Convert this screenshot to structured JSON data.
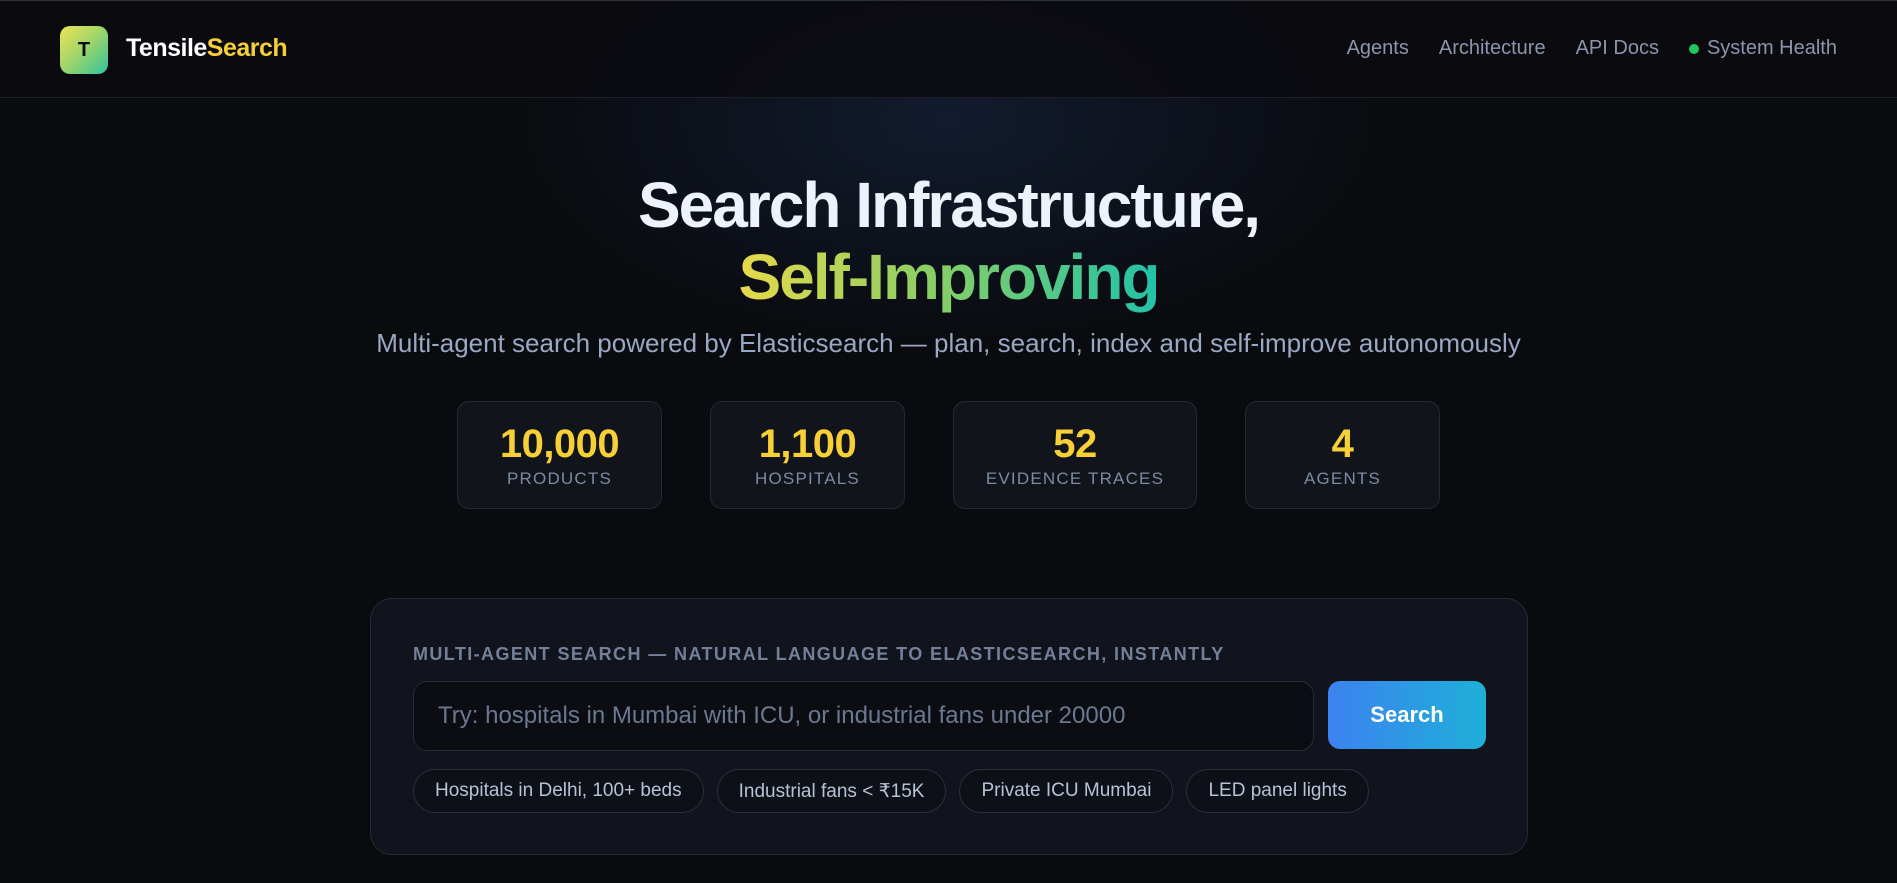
{
  "brand": {
    "logo_letter": "T",
    "name_part1": "Tensile",
    "name_part2": "Search",
    "accent_color": "#f4cf3a"
  },
  "nav": {
    "links": [
      "Agents",
      "Architecture",
      "API Docs"
    ],
    "health_label": "System Health",
    "health_status_color": "#23c55e"
  },
  "hero": {
    "title_line1": "Search Infrastructure,",
    "title_line2": "Self-Improving",
    "subtitle": "Multi-agent search powered by Elasticsearch — plan, search, index and self-improve autonomously"
  },
  "stats": [
    {
      "value": "10,000",
      "label": "PRODUCTS"
    },
    {
      "value": "1,100",
      "label": "HOSPITALS"
    },
    {
      "value": "52",
      "label": "EVIDENCE TRACES"
    },
    {
      "value": "4",
      "label": "AGENTS"
    }
  ],
  "search": {
    "heading": "MULTI-AGENT SEARCH — NATURAL LANGUAGE TO ELASTICSEARCH, INSTANTLY",
    "placeholder": "Try: hospitals in Mumbai with ICU, or industrial fans under 20000",
    "value": "",
    "button_label": "Search",
    "suggestions": [
      "Hospitals in Delhi, 100+ beds",
      "Industrial fans < ₹15K",
      "Private ICU Mumbai",
      "LED panel lights"
    ]
  }
}
